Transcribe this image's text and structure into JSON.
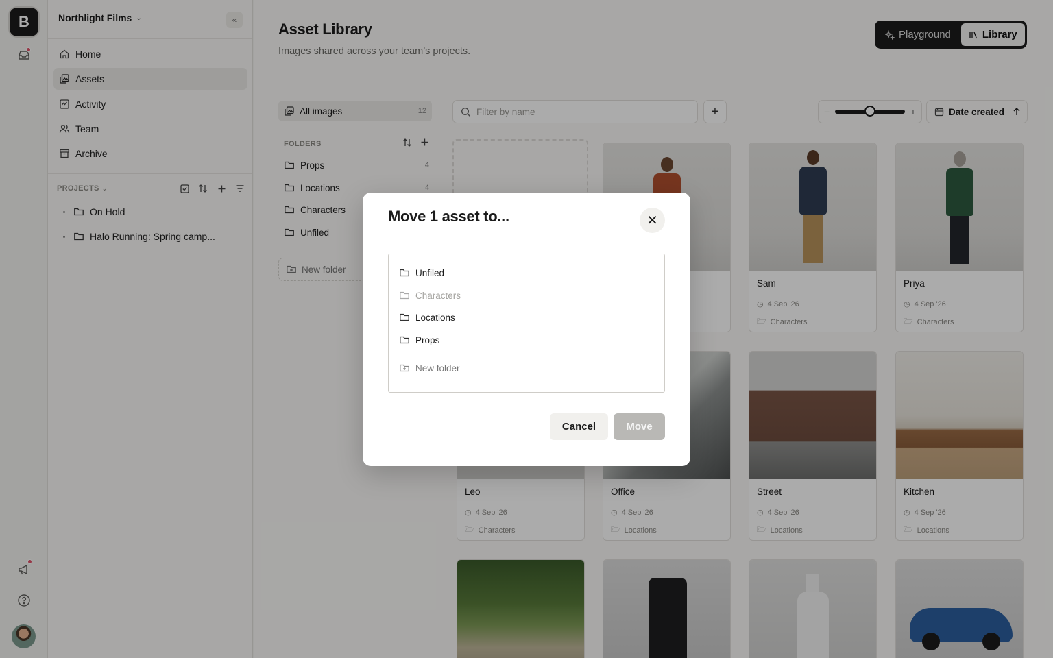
{
  "workspace": {
    "name": "Northlight Films",
    "logo_letter": "B"
  },
  "nav": [
    {
      "label": "Home",
      "icon": "home-icon"
    },
    {
      "label": "Assets",
      "icon": "assets-icon",
      "active": true
    },
    {
      "label": "Activity",
      "icon": "activity-icon"
    },
    {
      "label": "Team",
      "icon": "team-icon"
    },
    {
      "label": "Archive",
      "icon": "archive-icon"
    }
  ],
  "projects": {
    "heading": "PROJECTS",
    "items": [
      {
        "label": "On Hold"
      },
      {
        "label": "Halo Running: Spring camp..."
      }
    ]
  },
  "header": {
    "title": "Asset Library",
    "subtitle": "Images shared across your team’s projects.",
    "segments": [
      {
        "label": "Playground",
        "icon": "sparkle-icon"
      },
      {
        "label": "Library",
        "icon": "library-icon",
        "active": true
      }
    ]
  },
  "library": {
    "all_images": {
      "label": "All images",
      "count": "12"
    },
    "folders_heading": "FOLDERS",
    "folders": [
      {
        "label": "Props",
        "count": "4"
      },
      {
        "label": "Locations",
        "count": "4"
      },
      {
        "label": "Characters",
        "count": ""
      },
      {
        "label": "Unfiled",
        "count": ""
      }
    ],
    "new_folder": "New folder"
  },
  "toolbar": {
    "search_placeholder": "Filter by name",
    "zoom_level": 0.5,
    "sort_label": "Date created",
    "sort_direction": "ascending"
  },
  "assets": [
    {
      "name": "Sam",
      "date": "4 Sep '26",
      "folder": "Characters"
    },
    {
      "name": "Priya",
      "date": "4 Sep '26",
      "folder": "Characters"
    },
    {
      "name": "Leo",
      "date": "4 Sep '26",
      "folder": "Characters"
    },
    {
      "name": "Office",
      "date": "4 Sep '26",
      "folder": "Locations"
    },
    {
      "name": "Street",
      "date": "4 Sep '26",
      "folder": "Locations"
    },
    {
      "name": "Kitchen",
      "date": "4 Sep '26",
      "folder": "Locations"
    }
  ],
  "modal": {
    "title": "Move 1 asset to...",
    "options": [
      {
        "label": "Unfiled",
        "disabled": false
      },
      {
        "label": "Characters",
        "disabled": true
      },
      {
        "label": "Locations",
        "disabled": false
      },
      {
        "label": "Props",
        "disabled": false
      }
    ],
    "new_folder": "New folder",
    "cancel": "Cancel",
    "move": "Move"
  },
  "colors": {
    "accent": "#1b1b1b",
    "badge": "#e0546a",
    "move_disabled": "#b9b8b5"
  }
}
